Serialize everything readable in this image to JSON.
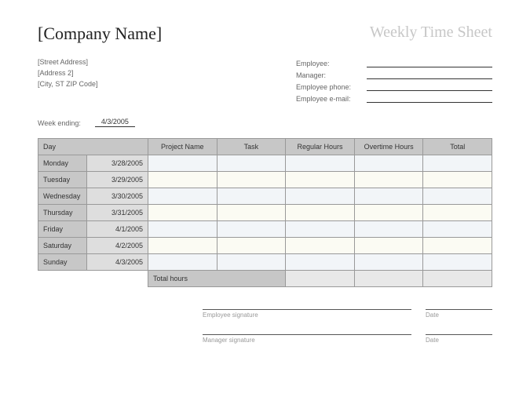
{
  "header": {
    "company": "[Company Name]",
    "title": "Weekly Time Sheet",
    "address1": "[Street Address]",
    "address2": "[Address 2]",
    "address3": "[City, ST ZIP Code]"
  },
  "info": {
    "employee_label": "Employee:",
    "manager_label": "Manager:",
    "phone_label": "Employee phone:",
    "email_label": "Employee e-mail:",
    "employee": "",
    "manager": "",
    "phone": "",
    "email": ""
  },
  "week_ending": {
    "label": "Week ending:",
    "value": "4/3/2005"
  },
  "columns": {
    "day": "Day",
    "project": "Project Name",
    "task": "Task",
    "regular": "Regular Hours",
    "overtime": "Overtime Hours",
    "total": "Total"
  },
  "rows": [
    {
      "day": "Monday",
      "date": "3/28/2005",
      "project": "",
      "task": "",
      "regular": "",
      "overtime": "",
      "total": ""
    },
    {
      "day": "Tuesday",
      "date": "3/29/2005",
      "project": "",
      "task": "",
      "regular": "",
      "overtime": "",
      "total": ""
    },
    {
      "day": "Wednesday",
      "date": "3/30/2005",
      "project": "",
      "task": "",
      "regular": "",
      "overtime": "",
      "total": ""
    },
    {
      "day": "Thursday",
      "date": "3/31/2005",
      "project": "",
      "task": "",
      "regular": "",
      "overtime": "",
      "total": ""
    },
    {
      "day": "Friday",
      "date": "4/1/2005",
      "project": "",
      "task": "",
      "regular": "",
      "overtime": "",
      "total": ""
    },
    {
      "day": "Saturday",
      "date": "4/2/2005",
      "project": "",
      "task": "",
      "regular": "",
      "overtime": "",
      "total": ""
    },
    {
      "day": "Sunday",
      "date": "4/3/2005",
      "project": "",
      "task": "",
      "regular": "",
      "overtime": "",
      "total": ""
    }
  ],
  "totals": {
    "label": "Total hours",
    "regular": "",
    "overtime": "",
    "total": ""
  },
  "signatures": {
    "employee": "Employee signature",
    "manager": "Manager signature",
    "date": "Date"
  }
}
